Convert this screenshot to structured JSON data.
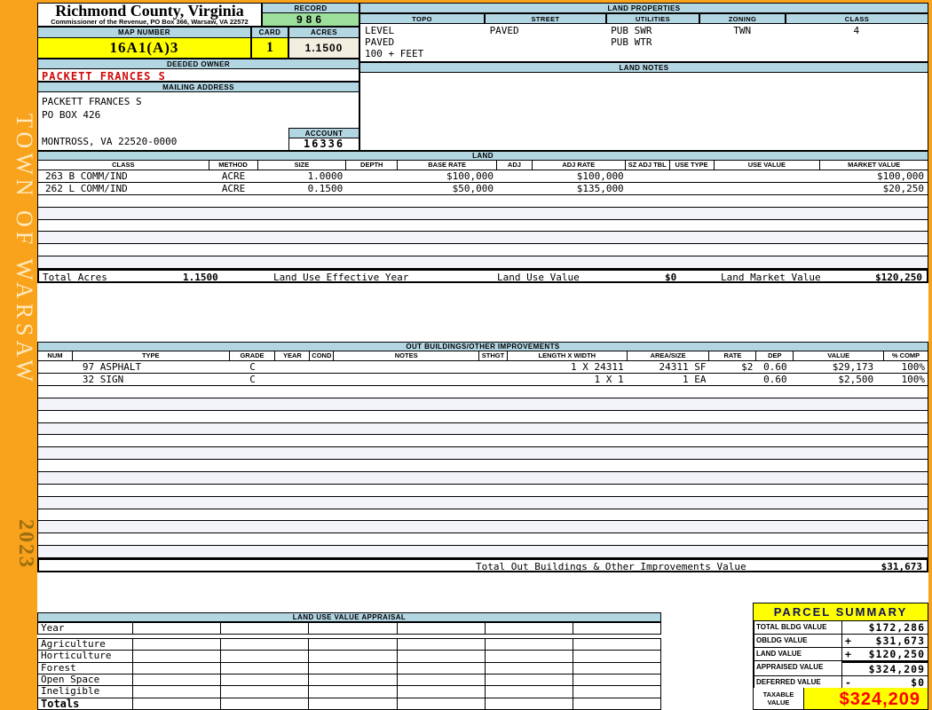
{
  "sidebar": {
    "town": "TOWN OF WARSAW",
    "year": "2023"
  },
  "header": {
    "county": "Richmond County, Virginia",
    "subtitle": "Commissioner of the Revenue, PO Box 366, Warsaw, VA 22572",
    "record_label": "RECORD",
    "record_value": "986",
    "map_number_label": "MAP NUMBER",
    "map_number": "16A1(A)3",
    "card_label": "CARD",
    "card_value": "1",
    "acres_label": "ACRES",
    "acres_value": "1.1500"
  },
  "owner": {
    "deeded_owner_label": "DEEDED OWNER",
    "owner_name": "PACKETT FRANCES S",
    "mailing_address_label": "MAILING ADDRESS",
    "address_line1": "PACKETT FRANCES S",
    "address_line2": "PO BOX 426",
    "address_line3": "",
    "address_line4": "MONTROSS, VA 22520-0000",
    "account_label": "ACCOUNT",
    "account_value": "16336"
  },
  "land_properties": {
    "title": "LAND PROPERTIES",
    "columns": [
      "TOPO",
      "STREET",
      "UTILITIES",
      "ZONING",
      "CLASS"
    ],
    "rows": [
      [
        "LEVEL",
        "PAVED",
        "PUB SWR",
        "TWN",
        "4"
      ],
      [
        "PAVED",
        "",
        "PUB WTR",
        "",
        ""
      ],
      [
        "100 + FEET",
        "",
        "",
        "",
        ""
      ]
    ],
    "notes_label": "LAND NOTES"
  },
  "land": {
    "title": "LAND",
    "columns": [
      "CLASS",
      "METHOD",
      "SIZE",
      "DEPTH",
      "BASE RATE",
      "ADJ",
      "ADJ RATE",
      "SZ ADJ TBL",
      "USE TYPE",
      "USE VALUE",
      "MARKET VALUE"
    ],
    "rows": [
      [
        "263 B COMM/IND",
        "ACRE",
        "1.0000",
        "",
        "$100,000",
        "",
        "$100,000",
        "",
        "",
        "",
        "$100,000"
      ],
      [
        "262 L COMM/IND",
        "ACRE",
        "0.1500",
        "",
        "$50,000",
        "",
        "$135,000",
        "",
        "",
        "",
        "$20,250"
      ]
    ],
    "empty_rows": 6,
    "total": {
      "total_acres_label": "Total Acres",
      "total_acres": "1.1500",
      "effective_year_label": "Land Use Effective Year",
      "use_value_label": "Land Use Value",
      "use_value": "$0",
      "market_value_label": "Land Market Value",
      "market_value": "$120,250"
    }
  },
  "out_buildings": {
    "title": "OUT BUILDINGS/OTHER IMPROVEMENTS",
    "columns": [
      "NUM",
      "TYPE",
      "GRADE",
      "YEAR",
      "COND",
      "NOTES",
      "STHGT",
      "LENGTH X WIDTH",
      "AREA/SIZE",
      "RATE",
      "DEP",
      "VALUE",
      "% COMP"
    ],
    "rows": [
      [
        "",
        "97 ASPHALT",
        "C",
        "",
        "",
        "",
        "",
        "1 X 24311",
        "24311 SF",
        "$2",
        "0.60",
        "$29,173",
        "100%"
      ],
      [
        "",
        "32 SIGN",
        "C",
        "",
        "",
        "",
        "",
        "1 X 1",
        "1 EA",
        "",
        "0.60",
        "$2,500",
        "100%"
      ]
    ],
    "empty_rows": 14,
    "total_label": "Total Out Buildings & Other Improvements Value",
    "total_value": "$31,673"
  },
  "land_use_appraisal": {
    "title": "LAND USE VALUE APPRAISAL",
    "row_labels": [
      "Year",
      "Agriculture",
      "Horticulture",
      "Forest",
      "Open Space",
      "Ineligible",
      "Totals"
    ],
    "data_columns": 6
  },
  "parcel_summary": {
    "title": "PARCEL SUMMARY",
    "rows": [
      {
        "label": "TOTAL BLDG VALUE",
        "op": "",
        "value": "$172,286"
      },
      {
        "label": "OBLDG VALUE",
        "op": "+",
        "value": "$31,673"
      },
      {
        "label": "LAND VALUE",
        "op": "+",
        "value": "$120,250"
      },
      {
        "label": "APPRAISED VALUE",
        "op": "",
        "value": "$324,209"
      },
      {
        "label": "DEFERRED VALUE",
        "op": "-",
        "value": "$0"
      }
    ],
    "taxable_label": "TAXABLE VALUE",
    "taxable_value": "$324,209"
  },
  "colors": {
    "sidebar_orange": "#F9A21C",
    "header_blue": "#B3D6E3",
    "record_green": "#9CE09C",
    "highlight_yellow": "#FFFF00",
    "acres_cream": "#F2EFE0",
    "owner_red": "#CF0A0A",
    "taxable_red": "#FF0000",
    "alt_row": "#F3F3FA"
  }
}
